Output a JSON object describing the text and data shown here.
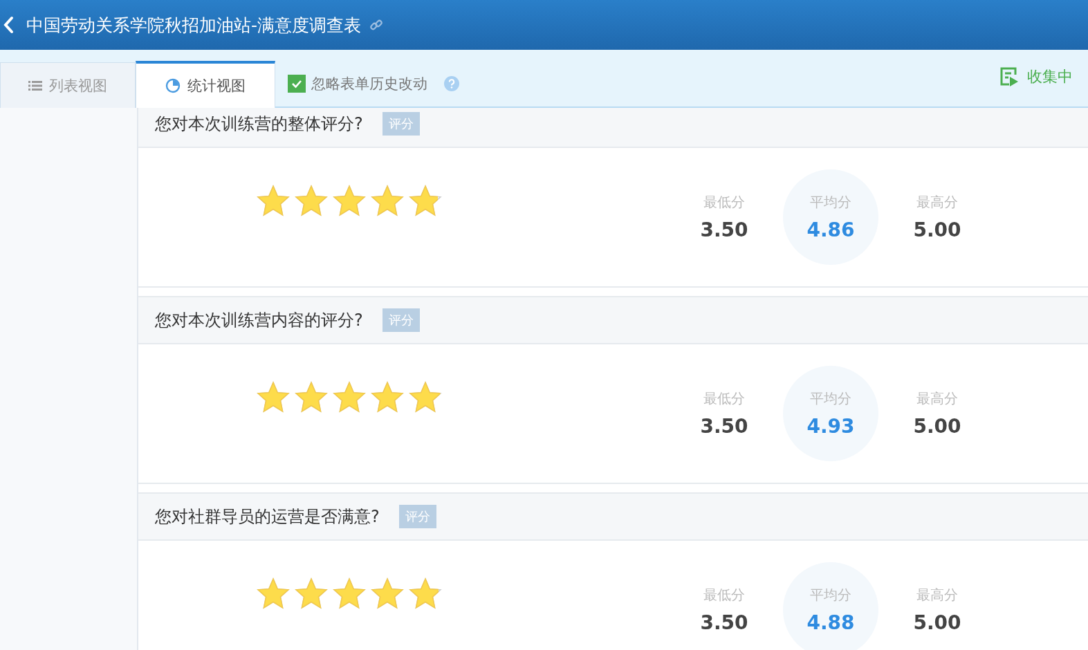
{
  "header": {
    "title": "中国劳动关系学院秋招加油站-满意度调查表"
  },
  "tabs": [
    {
      "label": "列表视图",
      "kind": "list",
      "selected": false
    },
    {
      "label": "统计视图",
      "kind": "chart",
      "selected": true
    }
  ],
  "ignore_history": {
    "label": "忽略表单历史改动",
    "checked": true
  },
  "status": {
    "label": "收集中"
  },
  "questions": [
    {
      "title": "您对本次训练营的整体评分?",
      "tag": "评分",
      "stars": 4.86,
      "stats": [
        {
          "label": "最低分",
          "value": "3.50",
          "kind": "plain"
        },
        {
          "label": "平均分",
          "value": "4.86",
          "kind": "highlight"
        },
        {
          "label": "最高分",
          "value": "5.00",
          "kind": "plain"
        }
      ]
    },
    {
      "title": "您对本次训练营内容的评分?",
      "tag": "评分",
      "stars": 4.93,
      "stats": [
        {
          "label": "最低分",
          "value": "3.50",
          "kind": "plain"
        },
        {
          "label": "平均分",
          "value": "4.93",
          "kind": "highlight"
        },
        {
          "label": "最高分",
          "value": "5.00",
          "kind": "plain"
        }
      ]
    },
    {
      "title": "您对社群导员的运营是否满意?",
      "tag": "评分",
      "stars": 4.88,
      "stats": [
        {
          "label": "最低分",
          "value": "3.50",
          "kind": "plain"
        },
        {
          "label": "平均分",
          "value": "4.88",
          "kind": "highlight"
        },
        {
          "label": "最高分",
          "value": "5.00",
          "kind": "plain"
        }
      ]
    }
  ]
}
